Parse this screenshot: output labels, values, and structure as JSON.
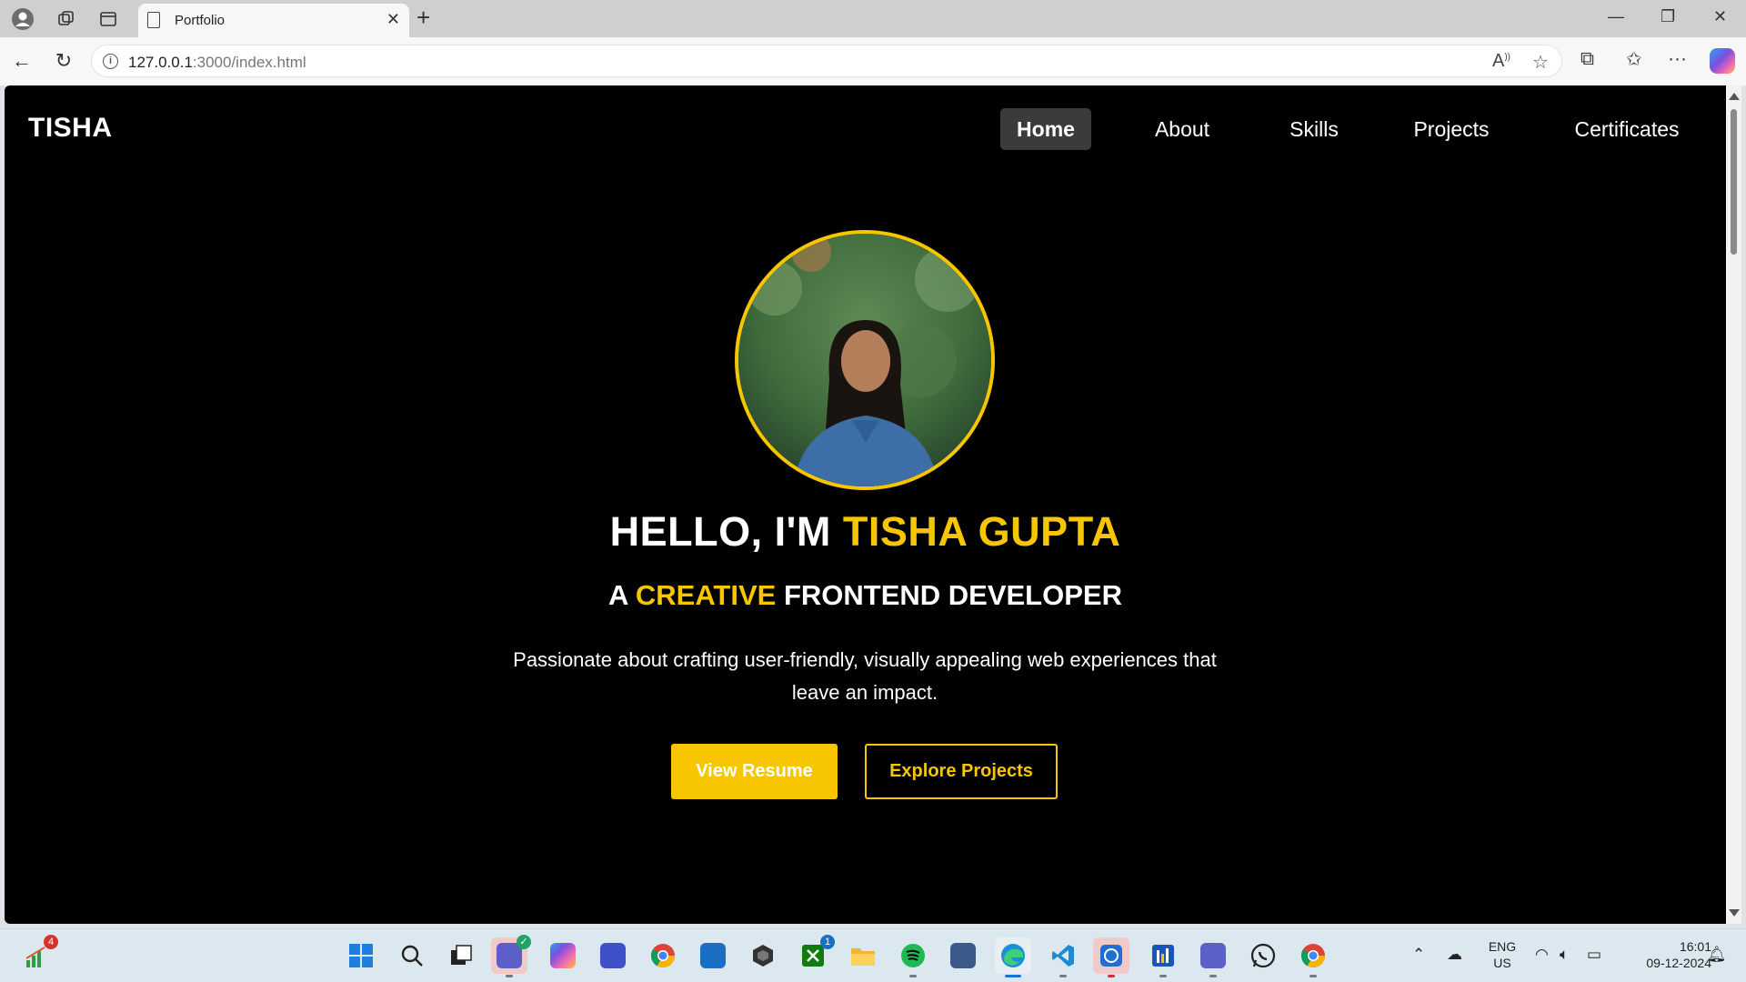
{
  "browser": {
    "tab_title": "Portfolio",
    "url_host": "127.0.0.1",
    "url_rest": ":3000/index.html"
  },
  "site": {
    "brand": "TISHA",
    "nav": [
      {
        "label": "Home",
        "active": true
      },
      {
        "label": "About",
        "active": false
      },
      {
        "label": "Skills",
        "active": false
      },
      {
        "label": "Projects",
        "active": false
      },
      {
        "label": "Certificates",
        "active": false
      }
    ],
    "hero": {
      "hello_prefix": "HELLO, I'M ",
      "name": "TISHA GUPTA",
      "role_a": "A ",
      "role_highlight": "CREATIVE",
      "role_rest": " FRONTEND DEVELOPER",
      "description": "Passionate about crafting user-friendly, visually appealing web experiences that leave an impact.",
      "primary_button": "View Resume",
      "secondary_button": "Explore Projects"
    },
    "accent_color": "#f7c600"
  },
  "taskbar": {
    "widget_badge": "4",
    "xbox_badge": "1",
    "lang_top": "ENG",
    "lang_bottom": "US",
    "time": "16:01",
    "date": "09-12-2024"
  }
}
